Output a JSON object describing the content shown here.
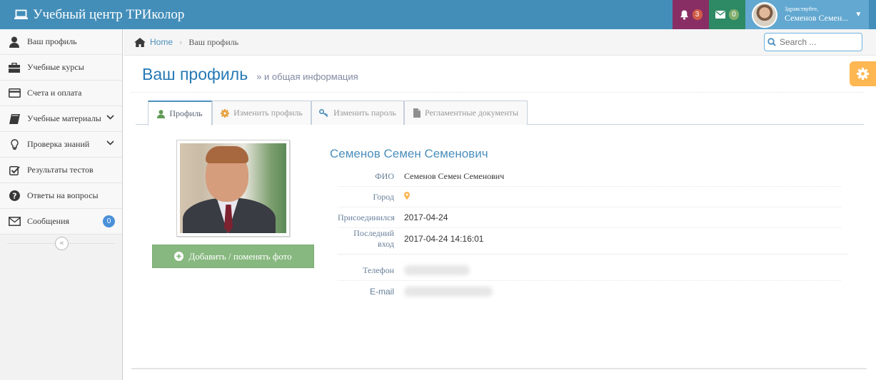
{
  "navbar": {
    "brand": "Учебный центр ТРИколор",
    "notifications_count": "3",
    "messages_count": "0",
    "user_greeting": "Здравствуйте,",
    "user_name": "Семенов Семен..."
  },
  "sidebar": {
    "items": [
      {
        "label": "Ваш профиль",
        "icon": "user-icon"
      },
      {
        "label": "Учебные курсы",
        "icon": "briefcase-icon"
      },
      {
        "label": "Счета и оплата",
        "icon": "credit-card-icon"
      },
      {
        "label": "Учебные материалы",
        "icon": "book-icon"
      },
      {
        "label": "Проверка знаний",
        "icon": "lightbulb-icon"
      },
      {
        "label": "Результаты тестов",
        "icon": "check-square-icon"
      },
      {
        "label": "Ответы на вопросы",
        "icon": "question-circle-icon"
      },
      {
        "label": "Сообщения",
        "icon": "envelope-icon",
        "badge": "0"
      }
    ],
    "collapse_glyph": "«"
  },
  "breadcrumb": {
    "home": "Home",
    "current": "Ваш профиль"
  },
  "search": {
    "placeholder": "Search ..."
  },
  "page": {
    "title": "Ваш профиль",
    "subtitle": "» и общая информация"
  },
  "tabs": [
    {
      "label": "Профиль",
      "active": true,
      "icon": "user-icon"
    },
    {
      "label": "Изменить профиль",
      "active": false,
      "icon": "cog-icon"
    },
    {
      "label": "Изменить пароль",
      "active": false,
      "icon": "key-icon"
    },
    {
      "label": "Регламентные документы",
      "active": false,
      "icon": "file-icon"
    }
  ],
  "profile": {
    "add_photo_button": "Добавить / поменять фото",
    "full_name": "Семенов Семен Семенович",
    "fields": {
      "fio_label": "ФИО",
      "fio_value": "Семенов Семен Семенович",
      "city_label": "Город",
      "joined_label": "Присоединился",
      "joined_value": "2017-04-24",
      "last_login_label": "Последний вход",
      "last_login_value": "2017-04-24 14:16:01",
      "phone_label": "Телефон",
      "email_label": "E-mail"
    }
  },
  "colors": {
    "navbar": "#438eb9",
    "bell_bg": "#892e65",
    "mail_bg": "#2e8965",
    "user_bg": "#62a8d1",
    "accent_blue": "#4c8fbd",
    "photo_button": "#87b87f",
    "settings_tab": "#ffb752",
    "map_marker": "#ffb752"
  }
}
